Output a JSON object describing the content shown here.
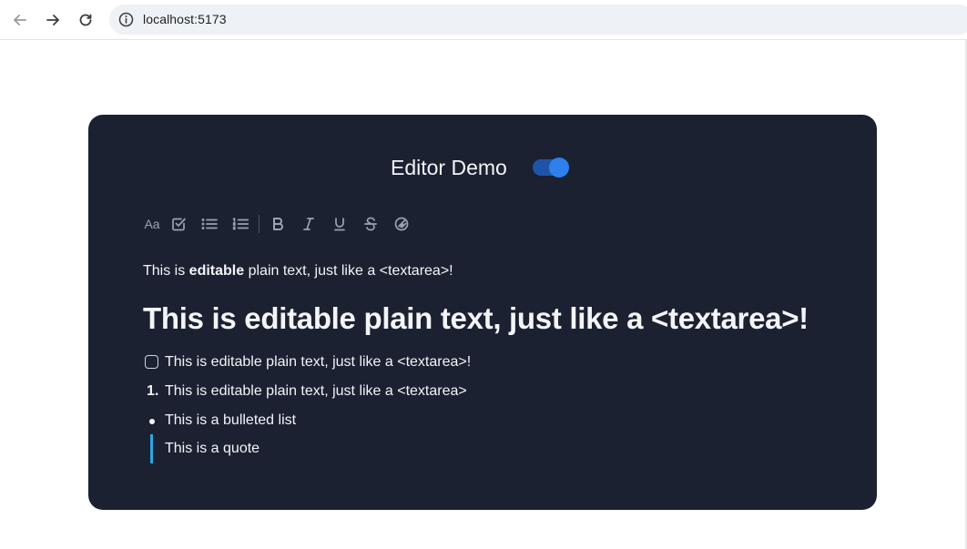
{
  "browser": {
    "url": "localhost:5173",
    "icons": [
      "back-arrow-icon",
      "forward-arrow-icon",
      "reload-icon",
      "site-info-icon"
    ]
  },
  "editor": {
    "title": "Editor Demo",
    "toggle_on": true,
    "toolbar": {
      "font_label": "Aa",
      "icons": [
        "font-icon",
        "checklist-icon",
        "bulleted-list-icon",
        "numbered-list-icon",
        "bold-icon",
        "italic-icon",
        "underline-icon",
        "strikethrough-icon",
        "clear-format-icon"
      ]
    },
    "content": {
      "paragraph_prefix": "This is ",
      "paragraph_bold": "editable",
      "paragraph_suffix": " plain text, just like a <textarea>!",
      "heading": "This is editable plain text, just like a <textarea>!",
      "check_item": "This is editable plain text, just like a <textarea>!",
      "numbered_marker": "1.",
      "numbered_item": "This is editable plain text, just like a <textarea>",
      "bullet_item": "This is a bulleted list",
      "quote": "This is a quote"
    }
  },
  "colors": {
    "card_bg": "#1b2130",
    "accent_toggle": "#2f80ed",
    "quote_bar": "#2aa8e0",
    "text": "#f2f4f8"
  }
}
